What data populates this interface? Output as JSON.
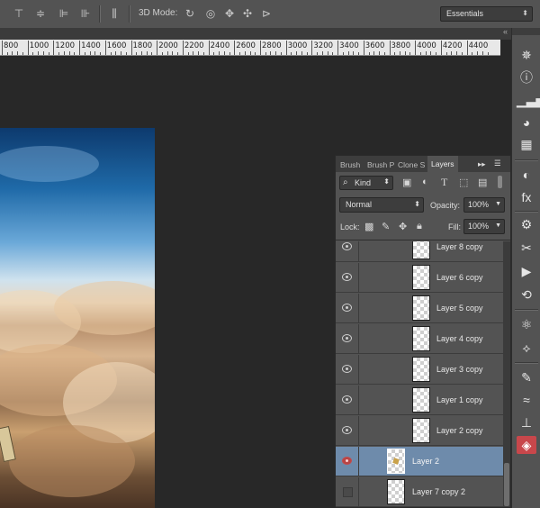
{
  "options_bar": {
    "mode_3d_label": "3D Mode:",
    "workspace_value": "Essentials"
  },
  "ruler": {
    "labels": [
      "800",
      "1000",
      "1200",
      "1400",
      "1600",
      "1800",
      "2000",
      "2200",
      "2400",
      "2600",
      "2800",
      "3000",
      "3200",
      "3400",
      "3600",
      "3800",
      "4000",
      "4200",
      "4400"
    ]
  },
  "layers_panel": {
    "tabs": [
      "Brush",
      "Brush P",
      "Clone S",
      "Layers"
    ],
    "active_tab": "Layers",
    "filter_kind": "Kind",
    "blend_mode": "Normal",
    "opacity_label": "Opacity:",
    "opacity_value": "100%",
    "lock_label": "Lock:",
    "fill_label": "Fill:",
    "fill_value": "100%",
    "layers": [
      {
        "name": "Layer 8 copy",
        "visible": true,
        "selected": false
      },
      {
        "name": "Layer 6 copy",
        "visible": true,
        "selected": false
      },
      {
        "name": "Layer 5 copy",
        "visible": true,
        "selected": false
      },
      {
        "name": "Layer 4 copy",
        "visible": true,
        "selected": false
      },
      {
        "name": "Layer 3 copy",
        "visible": true,
        "selected": false
      },
      {
        "name": "Layer 1 copy",
        "visible": true,
        "selected": false
      },
      {
        "name": "Layer 2 copy",
        "visible": true,
        "selected": false
      },
      {
        "name": "Layer 2",
        "visible": true,
        "selected": true
      },
      {
        "name": "Layer 7 copy 2",
        "visible": false,
        "selected": false
      }
    ]
  },
  "colors": {
    "ui_gray": "#535353",
    "selection": "#6e8bab",
    "active_dock": "#c8474b"
  }
}
